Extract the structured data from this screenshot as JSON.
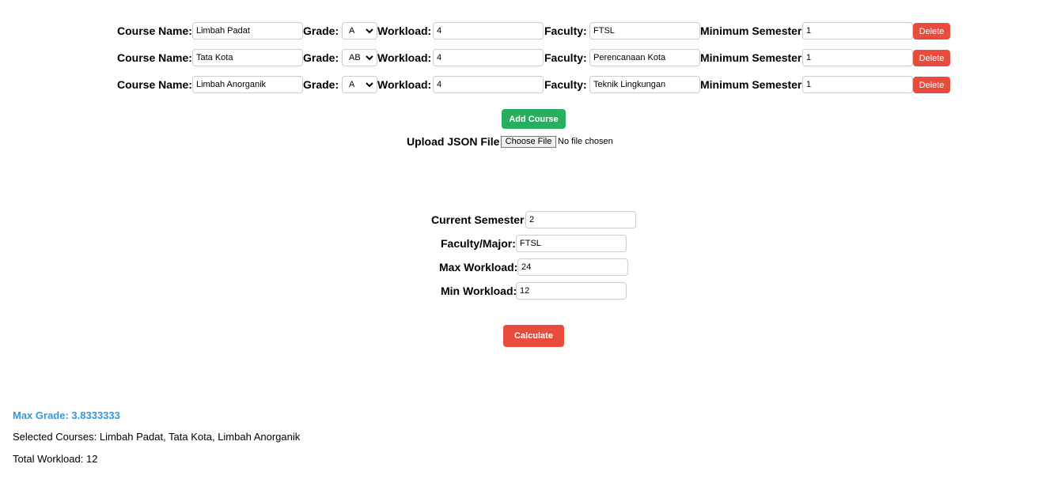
{
  "courses": [
    {
      "name_label": "Course Name:",
      "name": "Limbah Padat",
      "grade_label": "Grade:",
      "grade": "A",
      "workload_label": "Workload:",
      "workload": "4",
      "faculty_label": "Faculty:",
      "faculty": "FTSL",
      "min_sem_label": "Minimum Semester:",
      "min_sem": "1",
      "delete_label": "Delete"
    },
    {
      "name_label": "Course Name:",
      "name": "Tata Kota",
      "grade_label": "Grade:",
      "grade": "AB",
      "workload_label": "Workload:",
      "workload": "4",
      "faculty_label": "Faculty:",
      "faculty": "Perencanaan Kota",
      "min_sem_label": "Minimum Semester:",
      "min_sem": "1",
      "delete_label": "Delete"
    },
    {
      "name_label": "Course Name:",
      "name": "Limbah Anorganik",
      "grade_label": "Grade:",
      "grade": "A",
      "workload_label": "Workload:",
      "workload": "4",
      "faculty_label": "Faculty:",
      "faculty": "Teknik Lingkungan",
      "min_sem_label": "Minimum Semester:",
      "min_sem": "1",
      "delete_label": "Delete"
    }
  ],
  "add_course_label": "Add Course",
  "upload": {
    "label": "Upload JSON File:",
    "button": "Choose File",
    "status": "No file chosen"
  },
  "form": {
    "current_semester_label": "Current Semester:",
    "current_semester": "2",
    "faculty_label": "Faculty/Major:",
    "faculty": "FTSL",
    "max_workload_label": "Max Workload:",
    "max_workload": "24",
    "min_workload_label": "Min Workload:",
    "min_workload": "12"
  },
  "calculate_label": "Calculate",
  "results": {
    "max_grade": "Max Grade: 3.8333333",
    "selected": "Selected Courses: Limbah Padat, Tata Kota, Limbah Anorganik",
    "total": "Total Workload: 12"
  },
  "colors": {
    "add": "#27ae60",
    "delete": "#e74c3c",
    "result": "#3498db"
  }
}
